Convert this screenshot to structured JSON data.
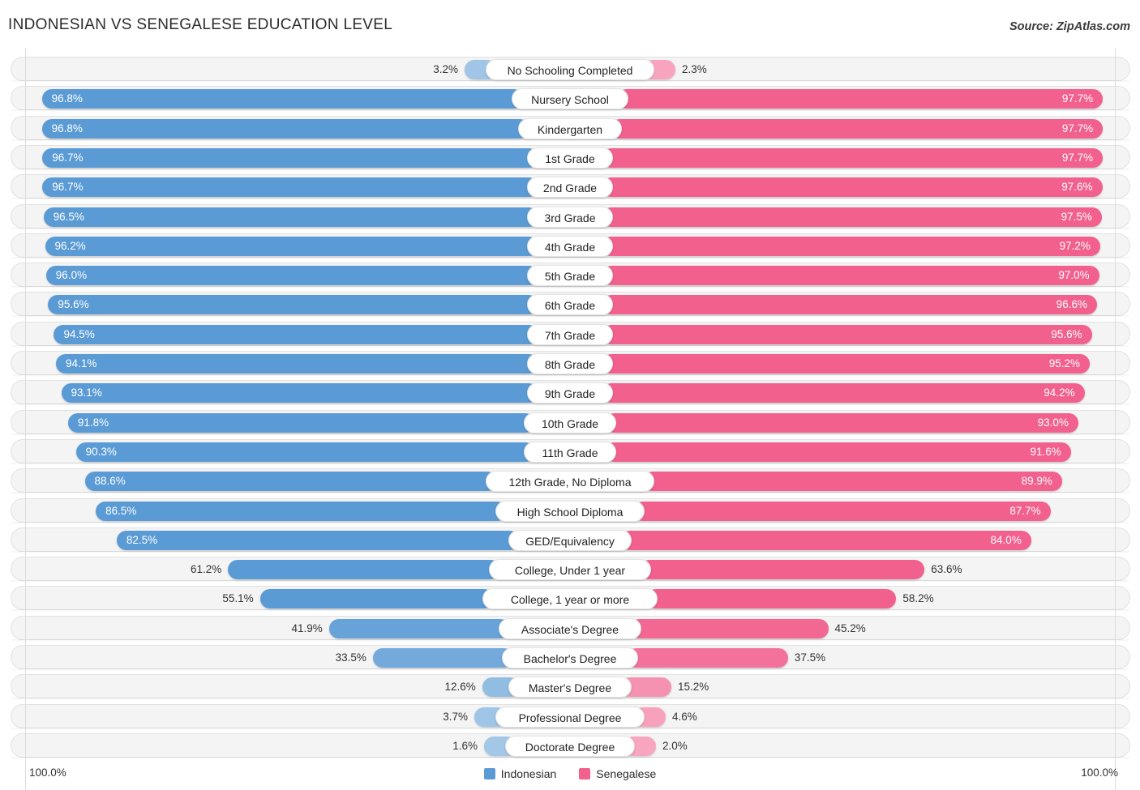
{
  "header": {
    "title": "INDONESIAN VS SENEGALESE EDUCATION LEVEL",
    "source": "Source: ZipAtlas.com"
  },
  "legend": {
    "left_label": "Indonesian",
    "right_label": "Senegalese",
    "left_color": "#5b9bd5",
    "right_color": "#f2608e"
  },
  "axis": {
    "left_max": "100.0%",
    "right_max": "100.0%"
  },
  "chart_data": {
    "type": "bar",
    "title": "INDONESIAN VS SENEGALESE EDUCATION LEVEL",
    "orientation": "horizontal-diverging",
    "xlabel": "",
    "ylabel": "",
    "xlim": [
      0,
      100
    ],
    "grid": true,
    "legend_position": "bottom-center",
    "categories": [
      "No Schooling Completed",
      "Nursery School",
      "Kindergarten",
      "1st Grade",
      "2nd Grade",
      "3rd Grade",
      "4th Grade",
      "5th Grade",
      "6th Grade",
      "7th Grade",
      "8th Grade",
      "9th Grade",
      "10th Grade",
      "11th Grade",
      "12th Grade, No Diploma",
      "High School Diploma",
      "GED/Equivalency",
      "College, Under 1 year",
      "College, 1 year or more",
      "Associate's Degree",
      "Bachelor's Degree",
      "Master's Degree",
      "Professional Degree",
      "Doctorate Degree"
    ],
    "series": [
      {
        "name": "Indonesian",
        "color": "#5b9bd5",
        "values": [
          3.2,
          96.8,
          96.8,
          96.7,
          96.7,
          96.5,
          96.2,
          96.0,
          95.6,
          94.5,
          94.1,
          93.1,
          91.8,
          90.3,
          88.6,
          86.5,
          82.5,
          61.2,
          55.1,
          41.9,
          33.5,
          12.6,
          3.7,
          1.6
        ],
        "labels": [
          "3.2%",
          "96.8%",
          "96.8%",
          "96.7%",
          "96.7%",
          "96.5%",
          "96.2%",
          "96.0%",
          "95.6%",
          "94.5%",
          "94.1%",
          "93.1%",
          "91.8%",
          "90.3%",
          "88.6%",
          "86.5%",
          "82.5%",
          "61.2%",
          "55.1%",
          "41.9%",
          "33.5%",
          "12.6%",
          "3.7%",
          "1.6%"
        ]
      },
      {
        "name": "Senegalese",
        "color": "#f2608e",
        "values": [
          2.3,
          97.7,
          97.7,
          97.7,
          97.6,
          97.5,
          97.2,
          97.0,
          96.6,
          95.6,
          95.2,
          94.2,
          93.0,
          91.6,
          89.9,
          87.7,
          84.0,
          63.6,
          58.2,
          45.2,
          37.5,
          15.2,
          4.6,
          2.0
        ],
        "labels": [
          "2.3%",
          "97.7%",
          "97.7%",
          "97.7%",
          "97.6%",
          "97.5%",
          "97.2%",
          "97.0%",
          "96.6%",
          "95.6%",
          "95.2%",
          "94.2%",
          "93.0%",
          "91.6%",
          "89.9%",
          "87.7%",
          "84.0%",
          "63.6%",
          "58.2%",
          "45.2%",
          "37.5%",
          "15.2%",
          "4.6%",
          "2.0%"
        ]
      }
    ]
  }
}
